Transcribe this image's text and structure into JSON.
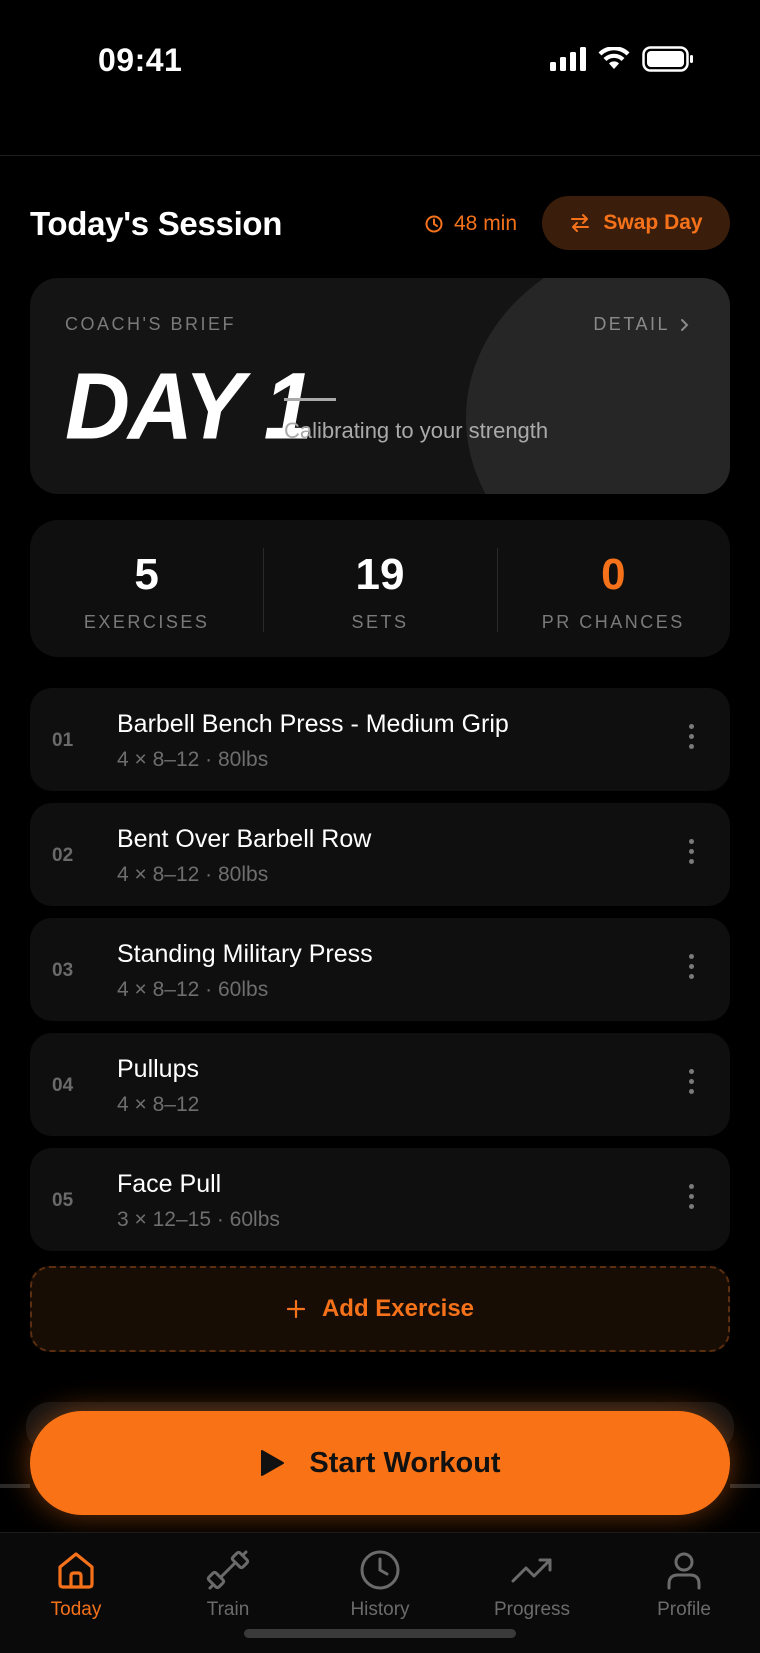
{
  "status": {
    "time": "09:41"
  },
  "header": {
    "title": "Today's Session",
    "duration": "48 min",
    "swap_label": "Swap Day"
  },
  "coach": {
    "label": "COACH'S BRIEF",
    "detail": "DETAIL",
    "day": "DAY 1",
    "subtitle": "Calibrating to your strength"
  },
  "stats": [
    {
      "value": "5",
      "label": "EXERCISES"
    },
    {
      "value": "19",
      "label": "SETS"
    },
    {
      "value": "0",
      "label": "PR CHANCES"
    }
  ],
  "exercises": [
    {
      "num": "01",
      "name": "Barbell Bench Press - Medium Grip",
      "meta": "4 × 8–12 · 80lbs"
    },
    {
      "num": "02",
      "name": "Bent Over Barbell Row",
      "meta": "4 × 8–12 · 80lbs"
    },
    {
      "num": "03",
      "name": "Standing Military Press",
      "meta": "4 × 8–12 · 60lbs"
    },
    {
      "num": "04",
      "name": "Pullups",
      "meta": "4 × 8–12"
    },
    {
      "num": "05",
      "name": "Face Pull",
      "meta": "3 × 12–15 · 60lbs"
    }
  ],
  "add_exercise": "Add Exercise",
  "start_workout": "Start Workout",
  "tabs": [
    {
      "label": "Today",
      "icon": "home-icon"
    },
    {
      "label": "Train",
      "icon": "dumbbell-icon"
    },
    {
      "label": "History",
      "icon": "clock-icon"
    },
    {
      "label": "Progress",
      "icon": "trending-up-icon"
    },
    {
      "label": "Profile",
      "icon": "user-icon"
    }
  ],
  "colors": {
    "accent": "#f97316",
    "background": "#000000",
    "card": "#0f0f0f"
  }
}
